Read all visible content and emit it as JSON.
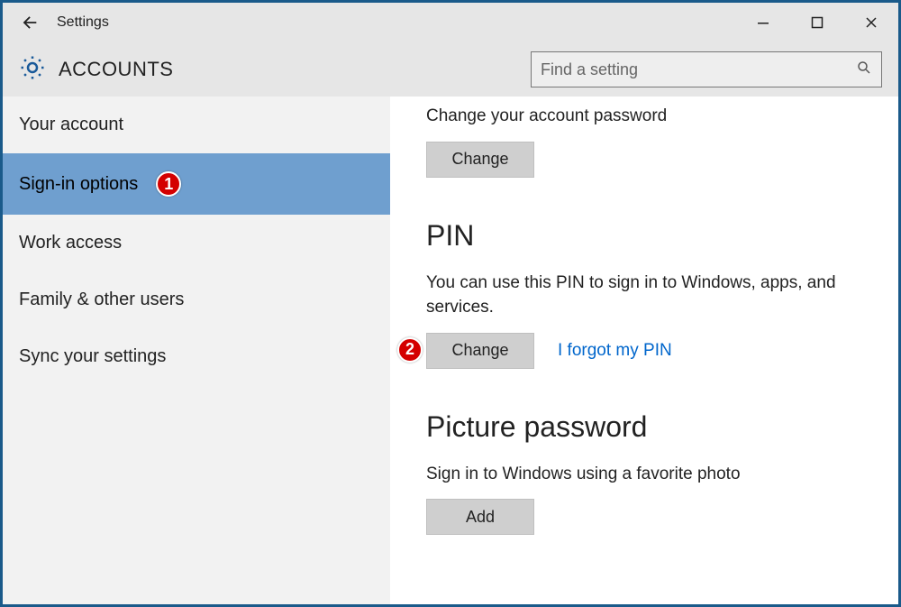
{
  "window": {
    "title": "Settings"
  },
  "header": {
    "section": "ACCOUNTS",
    "search_placeholder": "Find a setting"
  },
  "sidebar": {
    "items": [
      {
        "label": "Your account"
      },
      {
        "label": "Sign-in options"
      },
      {
        "label": "Work access"
      },
      {
        "label": "Family & other users"
      },
      {
        "label": "Sync your settings"
      }
    ]
  },
  "annotations": {
    "sidebar_badge": "1",
    "pin_badge": "2"
  },
  "content": {
    "password": {
      "desc": "Change your account password",
      "button": "Change"
    },
    "pin": {
      "heading": "PIN",
      "desc": "You can use this PIN to sign in to Windows, apps, and services.",
      "button": "Change",
      "link": "I forgot my PIN"
    },
    "picture": {
      "heading": "Picture password",
      "desc": "Sign in to Windows using a favorite photo",
      "button": "Add"
    }
  }
}
